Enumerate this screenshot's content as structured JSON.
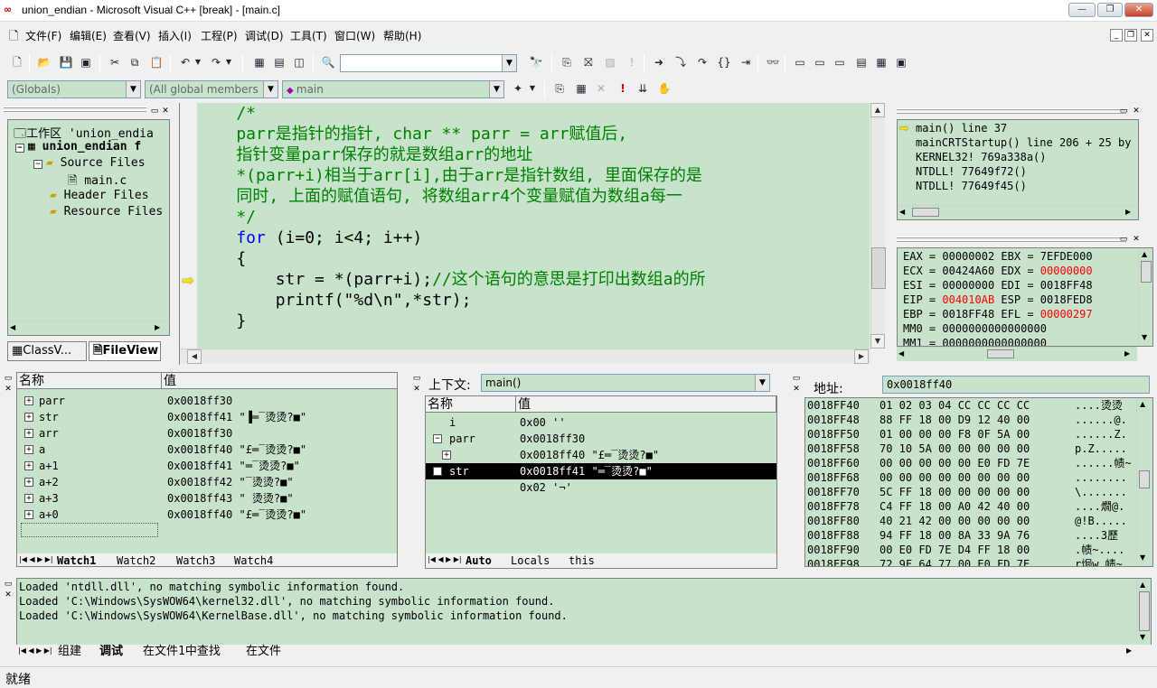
{
  "title": "union_endian - Microsoft Visual C++ [break] - [main.c]",
  "window_buttons": {
    "minimize": "—",
    "restore": "❐",
    "close": "✕"
  },
  "menus": [
    "文件(F)",
    "编辑(E)",
    "查看(V)",
    "插入(I)",
    "工程(P)",
    "调试(D)",
    "工具(T)",
    "窗口(W)",
    "帮助(H)"
  ],
  "toolbar": {
    "find_combo": "",
    "scope_combo": "(Globals)",
    "members_combo": "(All global members",
    "function_combo": "main"
  },
  "workspace": {
    "items": [
      {
        "label": "工作区 'union_endia"
      },
      {
        "label": "union_endian f"
      },
      {
        "label": "Source Files"
      },
      {
        "label": "main.c"
      },
      {
        "label": "Header Files"
      },
      {
        "label": "Resource Files"
      }
    ],
    "tabs": [
      "ClassV...",
      "FileView"
    ]
  },
  "code_lines": [
    {
      "text": "    /*",
      "cls": "cmt"
    },
    {
      "text": "    parr是指针的指针, char ** parr = arr赋值后,",
      "cls": "cmt"
    },
    {
      "text": "    指针变量parr保存的就是数组arr的地址",
      "cls": "cmt"
    },
    {
      "text": "    *(parr+i)相当于arr[i],由于arr是指针数组, 里面保存的是",
      "cls": "cmt"
    },
    {
      "text": "    同时, 上面的赋值语句, 将数组arr4个变量赋值为数组a每一",
      "cls": "cmt"
    },
    {
      "text": "    */",
      "cls": "cmt"
    },
    {
      "text": "    for",
      "cls": "kw",
      "rest": " (i=0; i<4; i++)"
    },
    {
      "text": "    {",
      "cls": ""
    },
    {
      "text": "        str = *(parr+i);",
      "cls": "",
      "rest2": "//这个语句的意思是打印出数组a的所"
    },
    {
      "text": "        printf(\"%d\\n\",*str);",
      "cls": ""
    },
    {
      "text": "    }",
      "cls": ""
    }
  ],
  "call_stack": [
    "main() line 37",
    "mainCRTStartup() line 206 + 25 by",
    "KERNEL32! 769a338a()",
    "NTDLL! 77649f72()",
    "NTDLL! 77649f45()"
  ],
  "registers": [
    {
      "a": "EAX",
      "av": "00000002",
      "b": "EBX",
      "bv": "7EFDE000",
      "ah": false,
      "bh": false
    },
    {
      "a": "ECX",
      "av": "00424A60",
      "b": "EDX",
      "bv": "00000000",
      "ah": false,
      "bh": true
    },
    {
      "a": "ESI",
      "av": "00000000",
      "b": "EDI",
      "bv": "0018FF48",
      "ah": false,
      "bh": false
    },
    {
      "a": "EIP",
      "av": "004010AB",
      "b": "ESP",
      "bv": "0018FED8",
      "ah": true,
      "bh": false
    },
    {
      "a": "EBP",
      "av": "0018FF48",
      "b": "EFL",
      "bv": "00000297",
      "ah": false,
      "bh": true
    },
    {
      "a": "MM0",
      "av": "0000000000000000",
      "b": "",
      "bv": "",
      "ah": false,
      "bh": false
    },
    {
      "a": "MM1",
      "av": "0000000000000000",
      "b": "",
      "bv": "",
      "ah": false,
      "bh": false
    }
  ],
  "watch": {
    "headers": [
      "名称",
      "值"
    ],
    "rows": [
      {
        "name": "parr",
        "value": "0x0018ff30"
      },
      {
        "name": "str",
        "value": "0x0018ff41 \"▐═̅ 烫烫?■\""
      },
      {
        "name": "arr",
        "value": "0x0018ff30"
      },
      {
        "name": "a",
        "value": "0x0018ff40 \"£═̅ 烫烫?■\""
      },
      {
        "name": "a+1",
        "value": "0x0018ff41 \"═̅ 烫烫?■\""
      },
      {
        "name": "a+2",
        "value": "0x0018ff42 \"̅ 烫烫?■\""
      },
      {
        "name": "a+3",
        "value": "0x0018ff43 \" 烫烫?■\""
      },
      {
        "name": "a+0",
        "value": "0x0018ff40 \"£═̅ 烫烫?■\""
      }
    ],
    "tabs": [
      "Watch1",
      "Watch2",
      "Watch3",
      "Watch4"
    ]
  },
  "variables": {
    "context_label": "上下文:",
    "context_value": "main()",
    "headers": [
      "名称",
      "值"
    ],
    "rows": [
      {
        "name": "i",
        "value": "0x00 ''"
      },
      {
        "name": "parr",
        "value": "0x0018ff30"
      },
      {
        "name": "",
        "value": "0x0018ff40 \"£═̅ 烫烫?■\""
      },
      {
        "name": "str",
        "value": "0x0018ff41 \"═̅ 烫烫?■\""
      },
      {
        "name": "",
        "value": "0x02 '¬'"
      }
    ],
    "tabs": [
      "Auto",
      "Locals",
      "this"
    ]
  },
  "memory": {
    "address_label": "地址:",
    "address_value": "0x0018ff40",
    "rows": [
      {
        "addr": "0018FF40",
        "bytes": "01 02 03 04 CC CC CC CC",
        "ascii": "....烫烫"
      },
      {
        "addr": "0018FF48",
        "bytes": "88 FF 18 00 D9 12 40 00",
        "ascii": "......@."
      },
      {
        "addr": "0018FF50",
        "bytes": "01 00 00 00 F8 0F 5A 00",
        "ascii": "......Z."
      },
      {
        "addr": "0018FF58",
        "bytes": "70 10 5A 00 00 00 00 00",
        "ascii": "p.Z....."
      },
      {
        "addr": "0018FF60",
        "bytes": "00 00 00 00 00 E0 FD 7E",
        "ascii": "......帻~"
      },
      {
        "addr": "0018FF68",
        "bytes": "00 00 00 00 00 00 00 00",
        "ascii": "........"
      },
      {
        "addr": "0018FF70",
        "bytes": "5C FF 18 00 00 00 00 00",
        "ascii": "\\......."
      },
      {
        "addr": "0018FF78",
        "bytes": "C4 FF 18 00 A0 42 40 00",
        "ascii": "....燗@."
      },
      {
        "addr": "0018FF80",
        "bytes": "40 21 42 00 00 00 00 00",
        "ascii": "@!B....."
      },
      {
        "addr": "0018FF88",
        "bytes": "94 FF 18 00 8A 33 9A 76",
        "ascii": "....3歷"
      },
      {
        "addr": "0018FF90",
        "bytes": "00 E0 FD 7E D4 FF 18 00",
        "ascii": ".帻~...."
      },
      {
        "addr": "0018FF98",
        "bytes": "72 9F 64 77 00 E0 FD 7E",
        "ascii": "r焗w.帻~"
      }
    ]
  },
  "output": {
    "lines": [
      "Loaded 'ntdll.dll', no matching symbolic information found.",
      "Loaded 'C:\\Windows\\SysWOW64\\kernel32.dll', no matching symbolic information found.",
      "Loaded 'C:\\Windows\\SysWOW64\\KernelBase.dll', no matching symbolic information found."
    ],
    "tabs": [
      "组建",
      "调试",
      "在文件1中查找",
      "在文件"
    ]
  },
  "status": "就绪",
  "colors": {
    "panel_bg": "#c8e3cb",
    "comment": "#008000",
    "keyword": "#0000ff",
    "changed_register": "#ff0000"
  }
}
